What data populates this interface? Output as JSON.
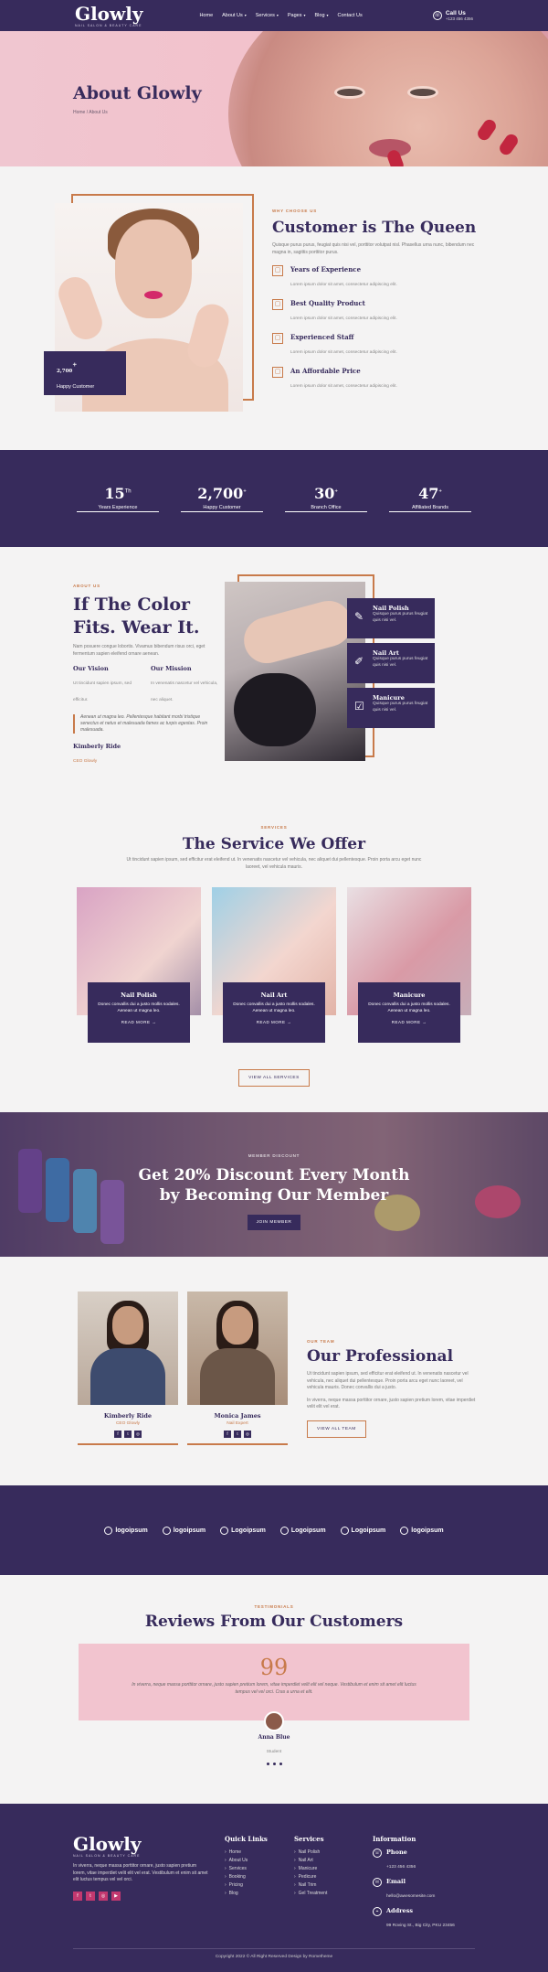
{
  "header": {
    "logo": "Glowly",
    "logo_sub": "NAIL SALON & BEAUTY CARE",
    "nav": [
      "Home",
      "About Us",
      "Services",
      "Pages",
      "Blog",
      "Contact Us"
    ],
    "nav_dropdown_flags": [
      false,
      true,
      true,
      true,
      true,
      false
    ],
    "call_label": "Call Us",
    "call_number": "+123 456 4356"
  },
  "hero": {
    "title": "About Glowly",
    "breadcrumb": "Home / About Us"
  },
  "intro": {
    "stat_value": "2,700",
    "stat_plus": "+",
    "stat_label": "Happy Customer",
    "kicker": "WHY CHOOSE US",
    "title": "Customer is The Queen",
    "text": "Quisque purus purus, feugiat quis nisi vel, porttitor volutpat nisl. Phasellus urna nunc, bibendum nec magna in, sagittis porttitor purus.",
    "features": [
      {
        "title": "Years of Experience",
        "text": "Lorem ipsum dolor sit amet, consectetur adipiscing elit.",
        "icon": "calendar-icon"
      },
      {
        "title": "Best Quality Product",
        "text": "Lorem ipsum dolor sit amet, consectetur adipiscing elit.",
        "icon": "bottle-icon"
      },
      {
        "title": "Experienced Staff",
        "text": "Lorem ipsum dolor sit amet, consectetur adipiscing elit.",
        "icon": "staff-icon"
      },
      {
        "title": "An Affordable Price",
        "text": "Lorem ipsum dolor sit amet, consectetur adipiscing elit.",
        "icon": "price-icon"
      }
    ]
  },
  "counters": [
    {
      "value": "15",
      "sup": "Th",
      "label": "Years Experience"
    },
    {
      "value": "2,700",
      "sup": "+",
      "label": "Happy Customer"
    },
    {
      "value": "30",
      "sup": "+",
      "label": "Branch Office"
    },
    {
      "value": "47",
      "sup": "+",
      "label": "Affiliated Brands"
    }
  ],
  "about": {
    "kicker": "ABOUT US",
    "title": "If The Color Fits. Wear It.",
    "text": "Nam posuere congue lobortis. Vivamus bibendum risus orci, eget fermentum sapien eleifend ornare aenean.",
    "vision_title": "Our Vision",
    "vision_text": "Ut tincidunt sapien ipsum, sed efficitur.",
    "mission_title": "Our Mission",
    "mission_text": "In venenatis nascetur vel vehicula, nec aliquet.",
    "quote": "Aenean ut magna leo. Pellentesque habitant morbi tristique senectus et netus et malesuada fames ac turpis egestas. Proin malesuada.",
    "signer": "Kimberly Ride",
    "signer_role": "CEO Glowly",
    "tags": [
      {
        "title": "Nail Polish",
        "text": "Quisque purus purus feugiat quis nisi vel.",
        "icon": "polish-icon"
      },
      {
        "title": "Nail Art",
        "text": "Quisque purus purus feugiat quis nisi vel.",
        "icon": "brush-icon"
      },
      {
        "title": "Manicure",
        "text": "Quisque purus purus feugiat quis nisi vel.",
        "icon": "manicure-icon"
      }
    ]
  },
  "services": {
    "kicker": "SERVICES",
    "title": "The Service We Offer",
    "text": "Ut tincidunt sapien ipsum, sed efficitur erat eleifend ut. In venenatis nascetur vel vehicula, nec aliquet dui pellentesque. Proin porta arcu eget nunc laoreet, vel vehicula mauris.",
    "cards": [
      {
        "title": "Nail Polish",
        "text": "Donec convallis dui a justo mollis sodales. Aenean ut magna leo.",
        "link": "READ MORE →"
      },
      {
        "title": "Nail Art",
        "text": "Donec convallis dui a justo mollis sodales. Aenean ut magna leo.",
        "link": "READ MORE →"
      },
      {
        "title": "Manicure",
        "text": "Donec convallis dui a justo mollis sodales. Aenean ut magna leo.",
        "link": "READ MORE →"
      }
    ],
    "view_all": "VIEW ALL SERVICES"
  },
  "discount": {
    "kicker": "MEMBER DISCOUNT",
    "title": "Get 20% Discount Every Month by Becoming Our Member",
    "button": "JOIN MEMBER"
  },
  "team": {
    "members": [
      {
        "name": "Kimberly Ride",
        "role": "CEO Glowly"
      },
      {
        "name": "Monica James",
        "role": "Nail Expert"
      }
    ],
    "kicker": "OUR TEAM",
    "title": "Our Professional",
    "text1": "Ut tincidunt sapien ipsum, sed efficitur erat eleifend ut. In venenatis nascetur vel vehicula, nec aliquet dui pellentesque. Proin porta arcu eget nunc laoreet, vel vehicula mauris. Donec convallis dui a justo.",
    "text2": "In viverra, neque massa porttitor ornare, justo sapien pretium lorem, vitae imperdiet velit elit vel erat.",
    "button": "VIEW ALL TEAM"
  },
  "logos": [
    "logoipsum",
    "logoipsum",
    "Logoipsum",
    "Logoipsum",
    "Logoipsum",
    "logoipsum"
  ],
  "reviews": {
    "kicker": "TESTIMONIALS",
    "title": "Reviews From Our Customers",
    "quote_mark": "99",
    "text": "In viverra, neque massa porttitor ornare, justo sapien pretium lorem, vitae imperdiet velit elit vel neque. Vestibulum et enim sit amet elit luctus tempus vel vel orci. Cras a urna et elit.",
    "name": "Anna Blue",
    "role": "Student"
  },
  "footer": {
    "logo": "Glowly",
    "logo_sub": "NAIL SALON & BEAUTY CARE",
    "about_text": "In viverra, neque massa porttitor ornare, justo sapien pretium lorem, vitae imperdiet velit elit vel erat. Vestibulum et enim sit amet elit luctus tempus vel vel orci.",
    "quick_links_title": "Quick Links",
    "quick_links": [
      "Home",
      "About Us",
      "Services",
      "Booking",
      "Pricing",
      "Blog"
    ],
    "services_title": "Services",
    "services": [
      "Nail Polish",
      "Nail Art",
      "Manicure",
      "Pedicure",
      "Nail Trim",
      "Gel Treatment"
    ],
    "info_title": "Information",
    "phone_label": "Phone",
    "phone": "+123 456 4356",
    "email_label": "Email",
    "email": "hello@awesomesite.com",
    "address_label": "Address",
    "address": "99 Roving St., Big City, PKU 23456",
    "copyright": "Copyright 2022 © All Right Reserved Design by Rometheme"
  },
  "colors": {
    "primary": "#372b5c",
    "accent": "#c87a4a",
    "pink": "#f2c4cf"
  }
}
